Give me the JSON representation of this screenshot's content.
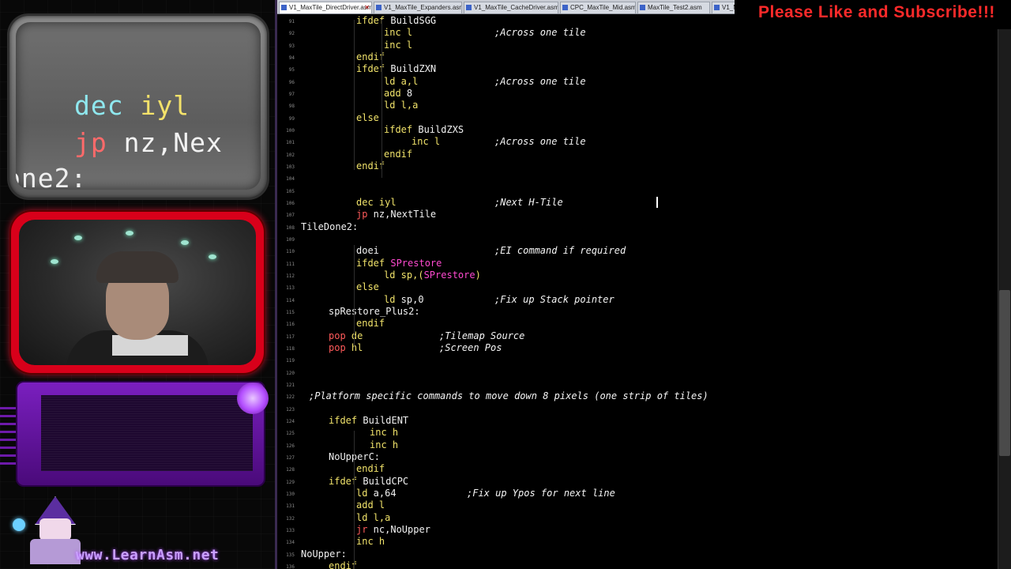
{
  "overlay": {
    "zoom": {
      "line1": {
        "op": "dec",
        "arg": "iyl"
      },
      "line2": {
        "op": "jp",
        "arg": "nz,Nex"
      },
      "line3": "one2:"
    },
    "website": "www.LearnAsm.net"
  },
  "banner": "Please Like and Subscribe!!!",
  "tabs": [
    {
      "label": "V1_MaxTile_DirectDriver.asm",
      "active": true
    },
    {
      "label": "V1_MaxTile_Expanders.asm",
      "active": false
    },
    {
      "label": "V1_MaxTile_CacheDriver.asm",
      "active": false
    },
    {
      "label": "CPC_MaxTile_Mid.asm",
      "active": false
    },
    {
      "label": "MaxTile_Test2.asm",
      "active": false
    },
    {
      "label": "V1_M...",
      "active": false
    }
  ],
  "line_numbers": [
    "91",
    "92",
    "93",
    "94",
    "95",
    "96",
    "97",
    "98",
    "99",
    "100",
    "101",
    "102",
    "103",
    "104",
    "105",
    "106",
    "107",
    "108",
    "109",
    "110",
    "111",
    "112",
    "113",
    "114",
    "115",
    "116",
    "117",
    "118",
    "119",
    "120",
    "121",
    "122",
    "123",
    "124",
    "125",
    "126",
    "127",
    "128",
    "129",
    "130",
    "131",
    "132",
    "133",
    "134",
    "135",
    "136"
  ],
  "code": [
    {
      "s": [
        {
          "t": "ifdef",
          "c": "y"
        },
        {
          "t": " BuildSGG",
          "c": "w"
        }
      ]
    },
    {
      "s": [
        {
          "t": "inc",
          "c": "y"
        },
        {
          "t": " l",
          "c": "y"
        }
      ],
      "cm": ";Across one tile"
    },
    {
      "s": [
        {
          "t": "inc",
          "c": "y"
        },
        {
          "t": " l",
          "c": "y"
        }
      ]
    },
    {
      "s": [
        {
          "t": "endif",
          "c": "y"
        }
      ]
    },
    {
      "s": [
        {
          "t": "ifdef",
          "c": "y"
        },
        {
          "t": " BuildZXN",
          "c": "w"
        }
      ]
    },
    {
      "s": [
        {
          "t": "ld",
          "c": "y"
        },
        {
          "t": " a,l",
          "c": "y"
        }
      ],
      "cm": ";Across one tile"
    },
    {
      "s": [
        {
          "t": "add",
          "c": "y"
        },
        {
          "t": " 8",
          "c": "w"
        }
      ]
    },
    {
      "s": [
        {
          "t": "ld",
          "c": "y"
        },
        {
          "t": " l,a",
          "c": "y"
        }
      ]
    },
    {
      "s": [
        {
          "t": "else",
          "c": "y"
        }
      ]
    },
    {
      "s": [
        {
          "t": "ifdef",
          "c": "y"
        },
        {
          "t": " BuildZXS",
          "c": "w"
        }
      ]
    },
    {
      "s": [
        {
          "t": "inc",
          "c": "y"
        },
        {
          "t": " l",
          "c": "y"
        }
      ],
      "cm": ";Across one tile"
    },
    {
      "s": [
        {
          "t": "endif",
          "c": "y"
        }
      ]
    },
    {
      "s": [
        {
          "t": "endif",
          "c": "y"
        }
      ]
    },
    {
      "s": []
    },
    {
      "s": []
    },
    {
      "s": [
        {
          "t": "dec",
          "c": "y"
        },
        {
          "t": " iyl",
          "c": "y"
        }
      ],
      "cm": ";Next H-Tile"
    },
    {
      "s": [
        {
          "t": "jp",
          "c": "r"
        },
        {
          "t": " nz,NextTile",
          "c": "w"
        }
      ]
    },
    {
      "s": [
        {
          "t": "TileDone2:",
          "c": "w"
        }
      ]
    },
    {
      "s": []
    },
    {
      "s": [
        {
          "t": "doei",
          "c": "w"
        }
      ],
      "cm": ";EI command if required"
    },
    {
      "s": [
        {
          "t": "ifdef",
          "c": "y"
        },
        {
          "t": " ",
          "c": "w"
        },
        {
          "t": "SPrestore",
          "c": "m"
        }
      ]
    },
    {
      "s": [
        {
          "t": "ld",
          "c": "y"
        },
        {
          "t": " sp,(",
          "c": "y"
        },
        {
          "t": "SPrestore",
          "c": "m"
        },
        {
          "t": ")",
          "c": "y"
        }
      ]
    },
    {
      "s": [
        {
          "t": "else",
          "c": "y"
        }
      ]
    },
    {
      "s": [
        {
          "t": "ld",
          "c": "y"
        },
        {
          "t": " sp,0",
          "c": "w"
        }
      ],
      "cm": ";Fix up Stack pointer"
    },
    {
      "s": [
        {
          "t": "spRestore_Plus2:",
          "c": "w"
        }
      ]
    },
    {
      "s": [
        {
          "t": "endif",
          "c": "y"
        }
      ]
    },
    {
      "s": [
        {
          "t": "pop",
          "c": "r"
        },
        {
          "t": " de",
          "c": "y"
        }
      ],
      "cm": ";Tilemap Source"
    },
    {
      "s": [
        {
          "t": "pop",
          "c": "r"
        },
        {
          "t": " hl",
          "c": "y"
        }
      ],
      "cm": ";Screen Pos"
    },
    {
      "s": []
    },
    {
      "s": []
    },
    {
      "s": []
    },
    {
      "s": [],
      "cm": ";Platform specific commands to move down 8 pixels (one strip of tiles)"
    },
    {
      "s": []
    },
    {
      "s": [
        {
          "t": "ifdef",
          "c": "y"
        },
        {
          "t": " BuildENT",
          "c": "w"
        }
      ]
    },
    {
      "s": [
        {
          "t": "inc",
          "c": "y"
        },
        {
          "t": " h",
          "c": "y"
        }
      ]
    },
    {
      "s": [
        {
          "t": "inc",
          "c": "y"
        },
        {
          "t": " h",
          "c": "y"
        }
      ]
    },
    {
      "s": [
        {
          "t": "NoUpperC:",
          "c": "w"
        }
      ]
    },
    {
      "s": [
        {
          "t": "endif",
          "c": "y"
        }
      ]
    },
    {
      "s": [
        {
          "t": "ifdef",
          "c": "y"
        },
        {
          "t": " BuildCPC",
          "c": "w"
        }
      ]
    },
    {
      "s": [
        {
          "t": "ld",
          "c": "y"
        },
        {
          "t": " a,64",
          "c": "w"
        }
      ],
      "cm": ";Fix up Ypos for next line"
    },
    {
      "s": [
        {
          "t": "add",
          "c": "y"
        },
        {
          "t": " l",
          "c": "y"
        }
      ]
    },
    {
      "s": [
        {
          "t": "ld",
          "c": "y"
        },
        {
          "t": " l,a",
          "c": "y"
        }
      ]
    },
    {
      "s": [
        {
          "t": "jr",
          "c": "r"
        },
        {
          "t": " nc,NoUpper",
          "c": "w"
        }
      ]
    },
    {
      "s": [
        {
          "t": "inc",
          "c": "y"
        },
        {
          "t": " h",
          "c": "y"
        }
      ]
    },
    {
      "s": [
        {
          "t": "NoUpper:",
          "c": "w"
        }
      ]
    },
    {
      "s": [
        {
          "t": "endif",
          "c": "y"
        }
      ]
    }
  ]
}
